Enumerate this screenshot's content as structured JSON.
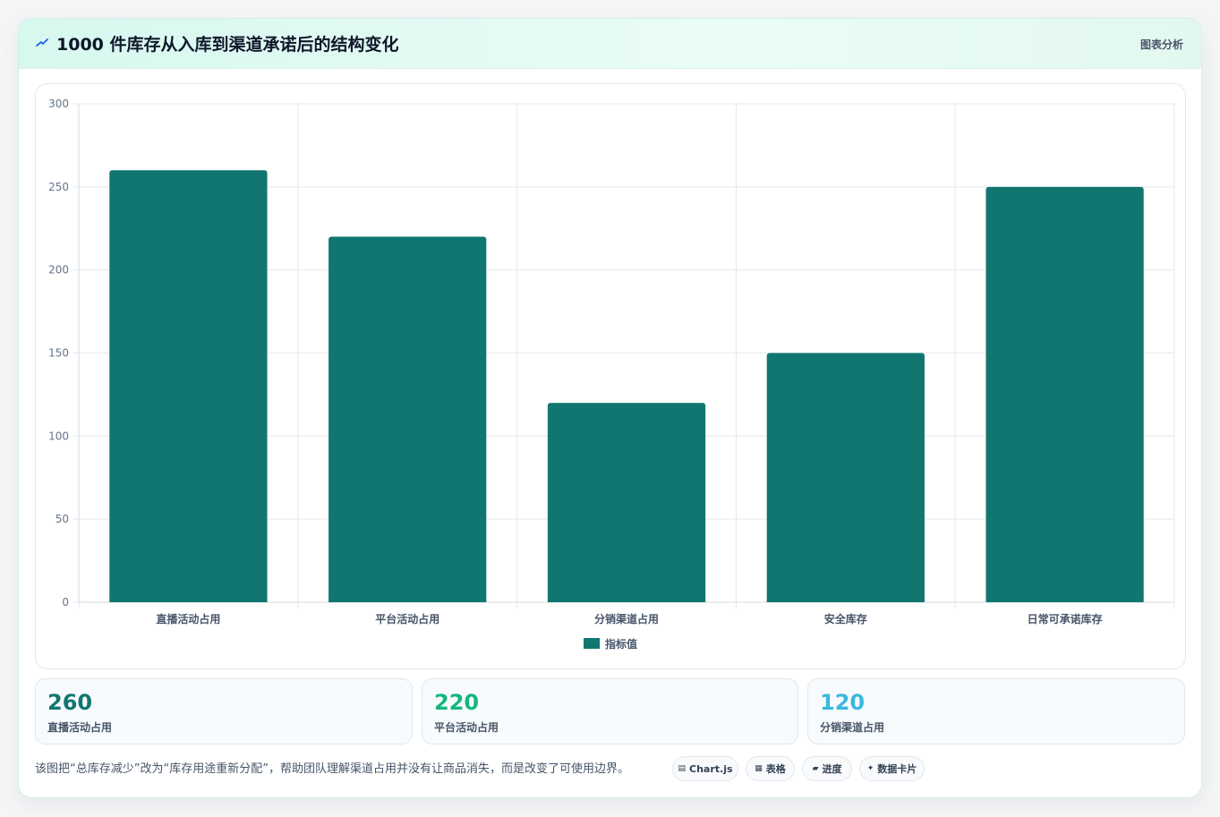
{
  "header": {
    "title": "1000 件库存从入库到渠道承诺后的结构变化",
    "tag": "图表分析",
    "icon": "spark-icon"
  },
  "chart_data": {
    "type": "bar",
    "categories": [
      "直播活动占用",
      "平台活动占用",
      "分销渠道占用",
      "安全库存",
      "日常可承诺库存"
    ],
    "series": [
      {
        "name": "指标值",
        "values": [
          260,
          220,
          120,
          150,
          250
        ],
        "color": "#11766f"
      }
    ],
    "ylim": [
      0,
      300
    ],
    "yticks": [
      0,
      50,
      100,
      150,
      200,
      250,
      300
    ],
    "grid": true,
    "legend": "bottom"
  },
  "stats": [
    {
      "value": "260",
      "label": "直播活动占用",
      "color": "#11766f"
    },
    {
      "value": "220",
      "label": "平台活动占用",
      "color": "#14b87f"
    },
    {
      "value": "120",
      "label": "分销渠道占用",
      "color": "#3ab8e0"
    }
  ],
  "footer": {
    "text": "该图把“总库存减少”改为“库存用途重新分配”，帮助团队理解渠道占用并没有让商品消失，而是改变了可使用边界。",
    "pills": [
      {
        "icon": "▤",
        "label": "Chart.js"
      },
      {
        "icon": "▦",
        "label": "表格"
      },
      {
        "icon": "▰",
        "label": "进度"
      },
      {
        "icon": "✦",
        "label": "数据卡片"
      }
    ]
  }
}
